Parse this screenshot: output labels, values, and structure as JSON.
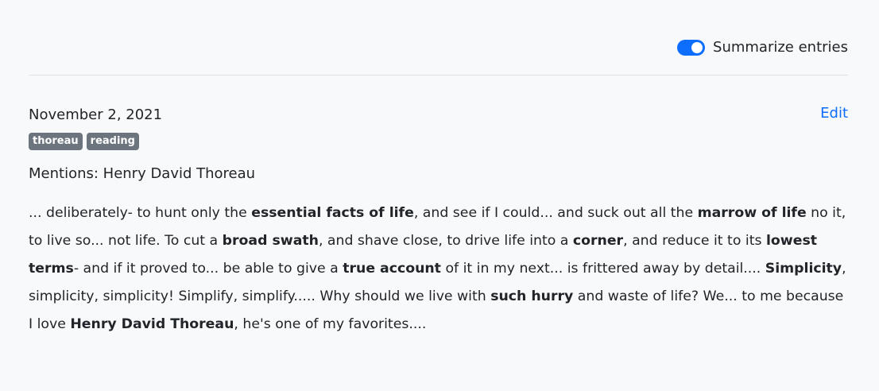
{
  "toolbar": {
    "summarize_label": "Summarize entries",
    "summarize_on": true
  },
  "entry": {
    "date": "November 2, 2021",
    "edit_label": "Edit",
    "tags": [
      "thoreau",
      "reading"
    ],
    "mentions_label": "Mentions: Henry David Thoreau",
    "excerpt": [
      {
        "text": "... deliberately- to hunt only the ",
        "bold": false
      },
      {
        "text": "essential facts of life",
        "bold": true
      },
      {
        "text": ", and see if I could... and suck out all the ",
        "bold": false
      },
      {
        "text": "marrow of life",
        "bold": true
      },
      {
        "text": " no it, to live so... not life. To cut a ",
        "bold": false
      },
      {
        "text": "broad swath",
        "bold": true
      },
      {
        "text": ", and shave close, to drive life into a ",
        "bold": false
      },
      {
        "text": "corner",
        "bold": true
      },
      {
        "text": ", and reduce it to its ",
        "bold": false
      },
      {
        "text": "lowest terms",
        "bold": true
      },
      {
        "text": "- and if it proved to... be able to give a ",
        "bold": false
      },
      {
        "text": "true account",
        "bold": true
      },
      {
        "text": " of it in my next... is frittered away by detail.... ",
        "bold": false
      },
      {
        "text": "Simplicity",
        "bold": true
      },
      {
        "text": ", simplicity, simplicity! Simplify, simplify..... Why should we live with ",
        "bold": false
      },
      {
        "text": "such hurry",
        "bold": true
      },
      {
        "text": " and waste of life? We... to me because I love ",
        "bold": false
      },
      {
        "text": "Henry David Thoreau",
        "bold": true
      },
      {
        "text": ", he's one of my favorites....",
        "bold": false
      }
    ]
  },
  "colors": {
    "accent": "#0d6efd",
    "tag_bg": "#6c757d",
    "page_bg": "#f8f9fa"
  }
}
